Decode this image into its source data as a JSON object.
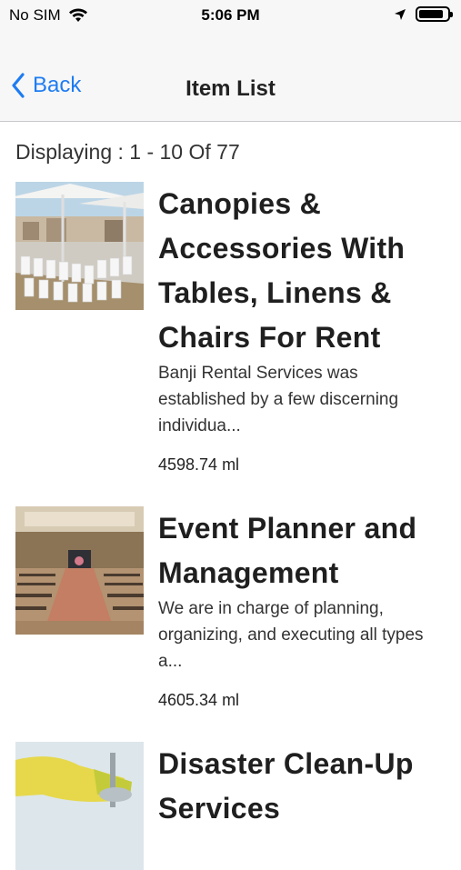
{
  "status_bar": {
    "carrier": "No SIM",
    "time": "5:06 PM",
    "battery_level": 0.85,
    "icons": [
      "wifi-icon",
      "location-arrow-icon",
      "battery-icon"
    ]
  },
  "nav": {
    "back_label": "Back",
    "title": "Item List",
    "accent_color": "#1e7cf2"
  },
  "list": {
    "display_text": "Displaying : 1 - 10 Of 77",
    "items": [
      {
        "title": "Canopies & Accessories With Tables, Linens & Chairs For Rent",
        "description": "Banji Rental Services was established by a few discerning individua...",
        "price": "4598.74 ml",
        "image": "canopies-rooftop-photo"
      },
      {
        "title": "Event Planner and Management",
        "description": "We are in charge of planning, organizing, and executing all types a...",
        "price": "4605.34 ml",
        "image": "ballroom-event-photo"
      },
      {
        "title": "Disaster Clean-Up Services",
        "description": "",
        "price": "",
        "image": "cleaning-glove-photo"
      }
    ]
  }
}
